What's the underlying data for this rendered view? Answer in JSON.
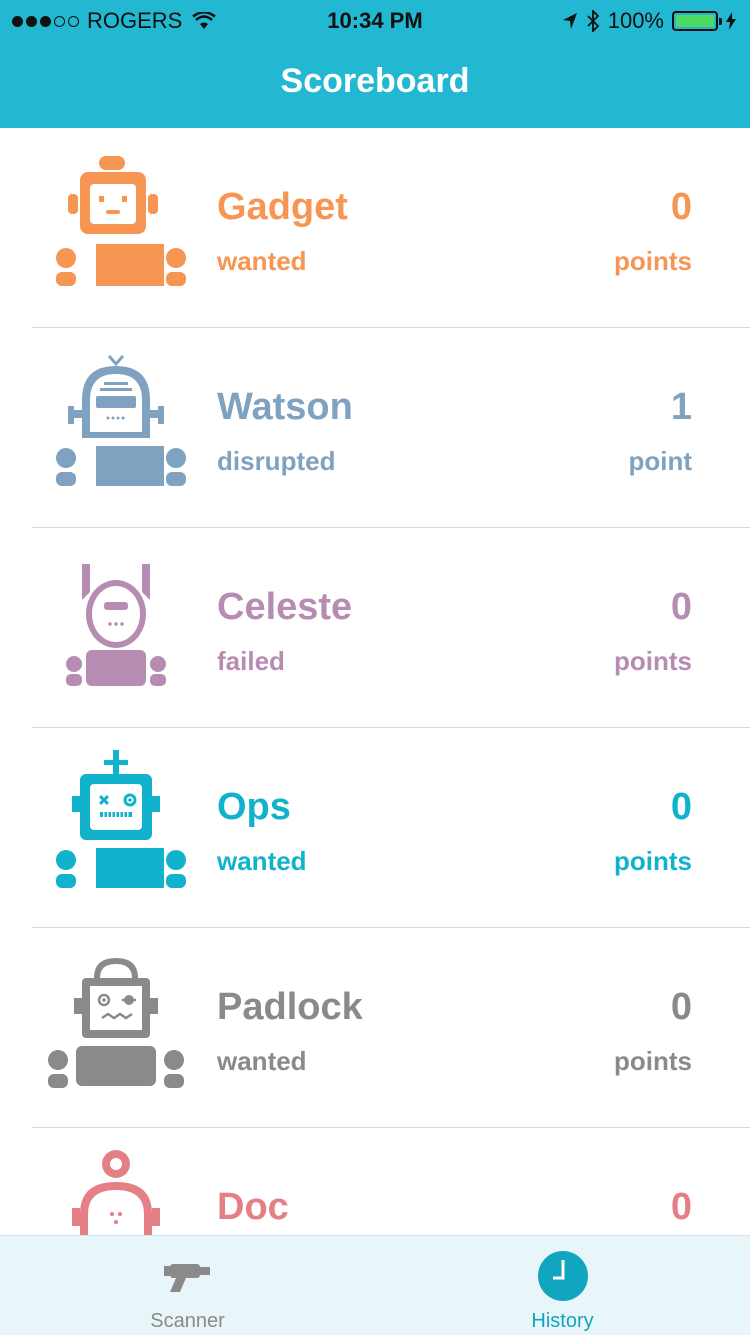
{
  "status_bar": {
    "carrier": "ROGERS",
    "time": "10:34 PM",
    "battery": "100%"
  },
  "nav": {
    "title": "Scoreboard"
  },
  "robots": [
    {
      "name": "Gadget",
      "status": "wanted",
      "score": "0",
      "unit": "points",
      "color": "#f79552",
      "icon": "gadget-robot-icon"
    },
    {
      "name": "Watson",
      "status": "disrupted",
      "score": "1",
      "unit": "point",
      "color": "#7ea2c0",
      "icon": "watson-robot-icon"
    },
    {
      "name": "Celeste",
      "status": "failed",
      "score": "0",
      "unit": "points",
      "color": "#b68cb3",
      "icon": "celeste-robot-icon"
    },
    {
      "name": "Ops",
      "status": "wanted",
      "score": "0",
      "unit": "points",
      "color": "#11b3cc",
      "icon": "ops-robot-icon"
    },
    {
      "name": "Padlock",
      "status": "wanted",
      "score": "0",
      "unit": "points",
      "color": "#8a8a8a",
      "icon": "padlock-robot-icon"
    },
    {
      "name": "Doc",
      "status": "",
      "score": "0",
      "unit": "",
      "color": "#e57f86",
      "icon": "doc-robot-icon"
    }
  ],
  "tabbar": {
    "tabs": [
      {
        "label": "Scanner",
        "icon": "ray-gun-icon",
        "active": false,
        "color": "#8a8a8a"
      },
      {
        "label": "History",
        "icon": "clock-icon",
        "active": true,
        "color": "#11a6c0"
      }
    ]
  }
}
